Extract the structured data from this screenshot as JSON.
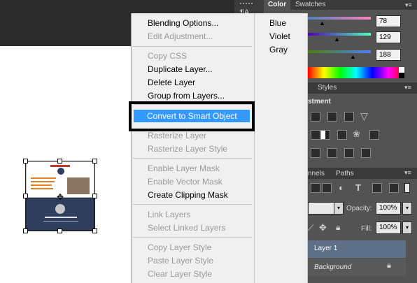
{
  "color_panel": {
    "tab_color": "Color",
    "tab_swatches": "Swatches",
    "values": [
      "78",
      "129",
      "188"
    ]
  },
  "styles_panel": {
    "tab_styles": "Styles",
    "adjustments_title": "stment"
  },
  "layers_panel": {
    "tab_channels": "nnels",
    "tab_paths": "Paths",
    "opacity_label": "Opacity:",
    "opacity_value": "100%",
    "fill_label": "Fill:",
    "fill_value": "100%",
    "layers": [
      {
        "name": "Layer 1",
        "selected": true
      },
      {
        "name": "Background",
        "selected": false
      }
    ]
  },
  "context_menu": {
    "items": [
      {
        "label": "Blending Options...",
        "enabled": true
      },
      {
        "label": "Edit Adjustment...",
        "enabled": false
      },
      {
        "label": "Copy CSS",
        "enabled": false
      },
      {
        "label": "Duplicate Layer...",
        "enabled": true
      },
      {
        "label": "Delete Layer",
        "enabled": true
      },
      {
        "label": "Group from Layers...",
        "enabled": true
      },
      {
        "label": "Convert to Smart Object",
        "enabled": true,
        "highlighted": true
      },
      {
        "label": "Rasterize Layer",
        "enabled": false
      },
      {
        "label": "Rasterize Layer Style",
        "enabled": false
      },
      {
        "label": "Enable Layer Mask",
        "enabled": false
      },
      {
        "label": "Enable Vector Mask",
        "enabled": false
      },
      {
        "label": "Create Clipping Mask",
        "enabled": true
      },
      {
        "label": "Link Layers",
        "enabled": false
      },
      {
        "label": "Select Linked Layers",
        "enabled": false
      },
      {
        "label": "Copy Layer Style",
        "enabled": false
      },
      {
        "label": "Paste Layer Style",
        "enabled": false
      },
      {
        "label": "Clear Layer Style",
        "enabled": false
      }
    ]
  },
  "color_submenu": {
    "items": [
      "Blue",
      "Violet",
      "Gray"
    ]
  },
  "colors": {
    "highlight": "#3399ff",
    "menu_bg": "#f0f0f0",
    "panel_bg": "#535353",
    "selected_layer": "#5e7087"
  }
}
